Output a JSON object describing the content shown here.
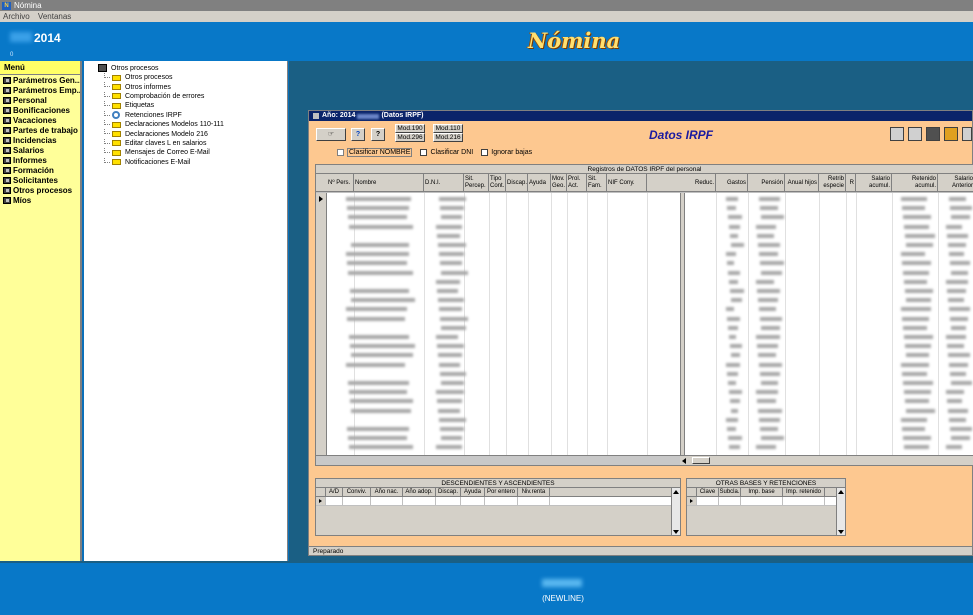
{
  "window": {
    "title": "Nómina",
    "icon": "app-icon"
  },
  "menubar": {
    "items": [
      "Archivo",
      "Ventanas"
    ]
  },
  "header": {
    "year": "2014",
    "small_text": "0",
    "app_title": "Nómina"
  },
  "sidebar": {
    "heading": "Menú",
    "items": [
      "Parámetros Gen...",
      "Parámetros Emp...",
      "Personal",
      "Bonificaciones",
      "Vacaciones",
      "Partes de trabajo",
      "Incidencias",
      "Salarios",
      "Informes",
      "Formación",
      "Solicitantes",
      "Otros procesos",
      "Míos"
    ]
  },
  "tree": {
    "root": "Otros procesos",
    "items": [
      "Otros procesos",
      "Otros informes",
      "Comprobación de errores",
      "Etiquetas",
      "Retenciones IRPF",
      "Declaraciones Modelos 110-111",
      "Declaraciones Modelo 216",
      "Editar claves L en salarios",
      "Mensajes de Correo E-Mail",
      "Notificaciones E-Mail"
    ]
  },
  "irpf_window": {
    "title_prefix": "Año: 2014",
    "title_suffix": "(Datos IRPF)",
    "heading": "Datos IRPF",
    "buttons": {
      "help": "?",
      "question": "?",
      "mod190": "Mod.190",
      "mod296": "Mod.296",
      "mod110": "Mod.110",
      "mod216": "Mod.216"
    },
    "checkboxes": {
      "sort_name": "Clasificar NOMBRE",
      "sort_dni": "Clasificar DNI",
      "ignore_leaves": "Ignorar bajas"
    },
    "grid_caption": "Registros de DATOS IRPF del personal",
    "left_columns": [
      "Nº Pers.",
      "Nombre",
      "D.N.I.",
      "Sit. Percep.",
      "Tipo Cont.",
      "Discap.",
      "Ayuda",
      "Mov. Geo.",
      "Prol. Act.",
      "Sit. Fam.",
      "NIF Cony."
    ],
    "right_columns": [
      "Reduc.",
      "Gastos",
      "Pensión",
      "Anual hijos",
      "Retrib especie",
      "R",
      "Salario acumul.",
      "Retenido acumul.",
      "Salario Anterior"
    ],
    "desc_grid": {
      "caption": "DESCENDIENTES Y ASCENDIENTES",
      "columns": [
        "A/D",
        "Conviv.",
        "Año nac.",
        "Año adop.",
        "Discap.",
        "Ayuda",
        "Por entero",
        "Niv.renta"
      ]
    },
    "other_grid": {
      "caption": "OTRAS BASES Y RETENCIONES",
      "columns": [
        "Clave",
        "Subcla.",
        "Imp. base",
        "Imp. retenido"
      ]
    },
    "status": "Preparado"
  },
  "footer": {
    "text": "(NEWLINE)"
  },
  "colors": {
    "background": "#0a6fb9",
    "sidebar": "#ffff99",
    "window_bg": "#fdc890",
    "title_gold": "#ffe070",
    "doc_title": "#1a1aa0"
  }
}
